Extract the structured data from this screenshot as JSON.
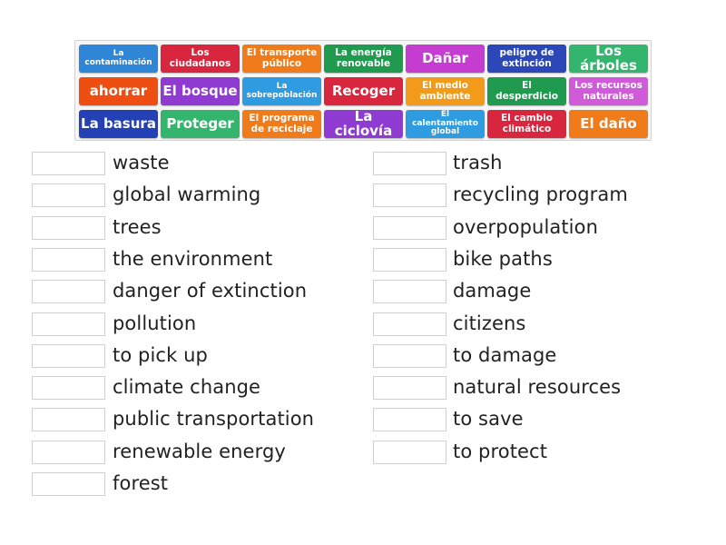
{
  "tiles": [
    {
      "label": "La contaminación",
      "color": "#2f86d6",
      "size": "sz-xs"
    },
    {
      "label": "Los ciudadanos",
      "color": "#d7263d",
      "size": "sz-sm"
    },
    {
      "label": "El transporte público",
      "color": "#f07b1a",
      "size": "sz-sm"
    },
    {
      "label": "La energía renovable",
      "color": "#1f9a4f",
      "size": "sz-sm"
    },
    {
      "label": "Dañar",
      "color": "#c43cd0",
      "size": "sz-big"
    },
    {
      "label": "peligro de extinción",
      "color": "#2b47b8",
      "size": "sz-sm"
    },
    {
      "label": "Los árboles",
      "color": "#34b56e",
      "size": "sz-big"
    },
    {
      "label": "ahorrar",
      "color": "#ee4e12",
      "size": "sz-big"
    },
    {
      "label": "El bosque",
      "color": "#8f3ad1",
      "size": "sz-big"
    },
    {
      "label": "La sobrepoblación",
      "color": "#2f9be0",
      "size": "sz-xs"
    },
    {
      "label": "Recoger",
      "color": "#d7263d",
      "size": "sz-big"
    },
    {
      "label": "El medio ambiente",
      "color": "#f29b1a",
      "size": "sz-sm"
    },
    {
      "label": "El desperdicio",
      "color": "#1f9a4f",
      "size": "sz-sm"
    },
    {
      "label": "Los recursos naturales",
      "color": "#d05bd9",
      "size": "sz-sm"
    },
    {
      "label": "La basura",
      "color": "#2440b5",
      "size": "sz-big"
    },
    {
      "label": "Proteger",
      "color": "#34b56e",
      "size": "sz-big"
    },
    {
      "label": "El programa de reciclaje",
      "color": "#f07b1a",
      "size": "sz-sm"
    },
    {
      "label": "La ciclovía",
      "color": "#8f3ad1",
      "size": "sz-big"
    },
    {
      "label": "El calentamiento global",
      "color": "#2f9be0",
      "size": "sz-xs"
    },
    {
      "label": "El cambio climático",
      "color": "#d7263d",
      "size": "sz-sm"
    },
    {
      "label": "El daño",
      "color": "#f07b1a",
      "size": "sz-big"
    }
  ],
  "clues_left": [
    "waste",
    "global warming",
    "trees",
    "the environment",
    "danger of extinction",
    "pollution",
    "to pick up",
    "climate change",
    "public transportation",
    "renewable energy",
    "forest"
  ],
  "clues_right": [
    "trash",
    "recycling program",
    "overpopulation",
    "bike paths",
    "damage",
    "citizens",
    "to damage",
    "natural resources",
    "to save",
    "to protect"
  ]
}
